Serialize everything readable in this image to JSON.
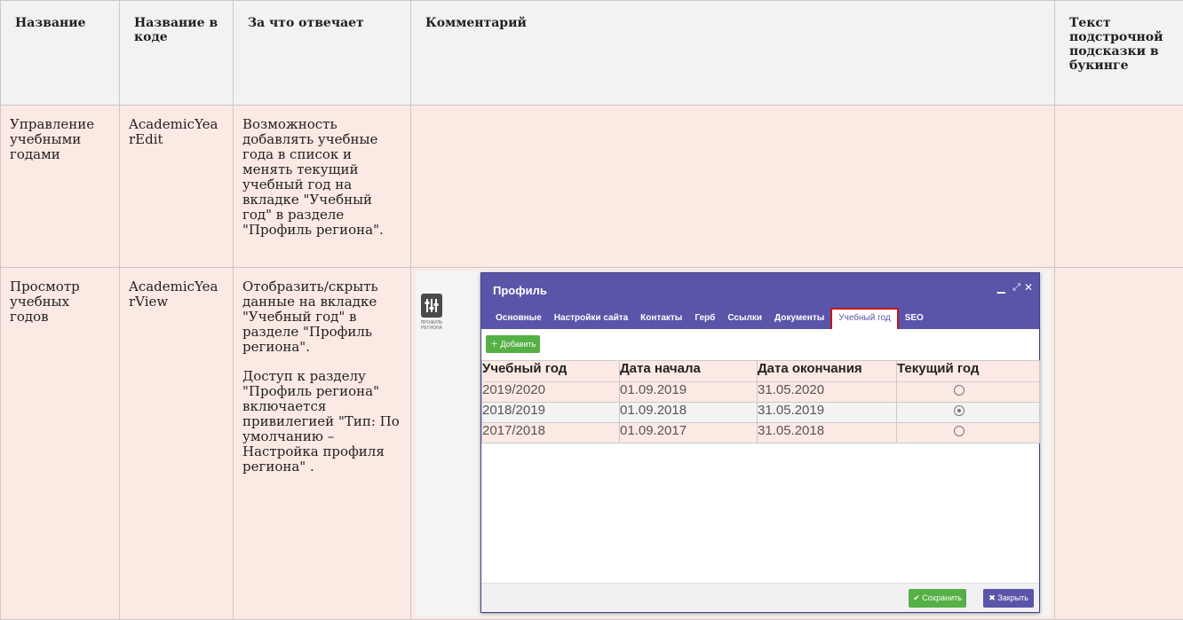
{
  "headers": [
    "Название",
    "Название в коде",
    "За что отвечает",
    "Комментарий",
    "Текст подстрочной подсказки в букинге"
  ],
  "rows": [
    {
      "name": "Управление учебными годами",
      "code": "AcademicYearEdit",
      "desc": [
        "Возможность добавлять учебные года в список и менять текущий учебный год на вкладке \"Учебный год\" в разделе \"Профиль региона\"."
      ],
      "comment": "",
      "hint": ""
    },
    {
      "name": "Просмотр учебных годов",
      "code": "AcademicYearView",
      "desc": [
        "Отобразить/скрыть данные на вкладке \"Учебный год\" в разделе \"Профиль региона\".",
        "Доступ к разделу \"Профиль региона\" включается привилегией \"Тип: По умолчанию – Настройка профиля региона\" ."
      ],
      "hint": ""
    }
  ],
  "screenshot": {
    "app_caption": "ПРОФИЛЬ РЕГИОНА",
    "app_icon": "sliders-icon",
    "window_title": "Профиль",
    "window_controls": [
      "minimize-icon",
      "expand-icon",
      "close-icon"
    ],
    "tabs": [
      "Основные",
      "Настройки сайта",
      "Контакты",
      "Герб",
      "Ссылки",
      "Документы",
      "Учебный год",
      "SEO"
    ],
    "active_tab": "Учебный год",
    "add_button": "Добавить",
    "columns": [
      "Учебный год",
      "Дата начала",
      "Дата окончания",
      "Текущий год"
    ],
    "years": [
      {
        "year": "2019/2020",
        "start": "01.09.2019",
        "end": "31.05.2020",
        "current": false
      },
      {
        "year": "2018/2019",
        "start": "01.09.2018",
        "end": "31.05.2019",
        "current": true
      },
      {
        "year": "2017/2018",
        "start": "01.09.2017",
        "end": "31.05.2018",
        "current": false
      }
    ],
    "save_button": "Сохранить",
    "close_button": "Закрыть",
    "colors": {
      "header": "#5a55a8",
      "green": "#55b046",
      "highlight": "#c4161c"
    }
  }
}
